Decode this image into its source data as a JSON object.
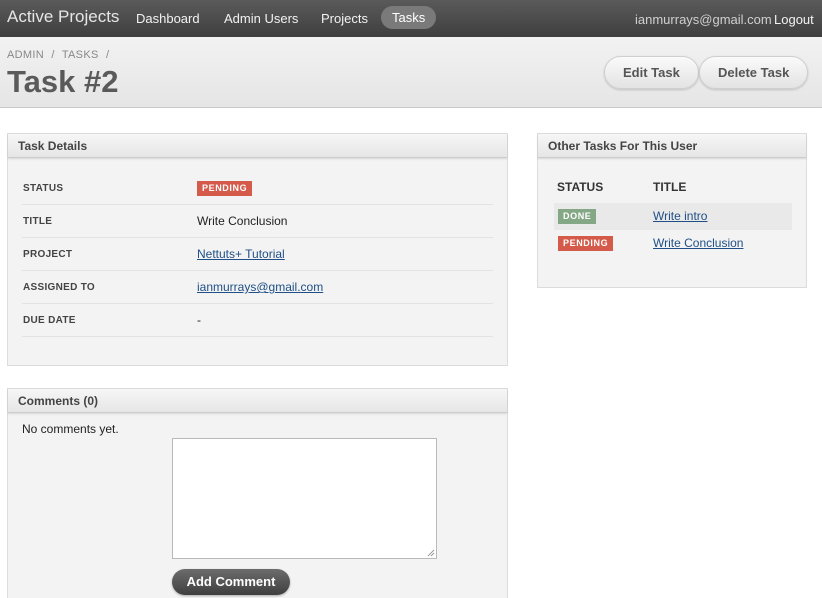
{
  "nav": {
    "brand": "Active Projects",
    "items": [
      {
        "label": "Dashboard",
        "active": false
      },
      {
        "label": "Admin Users",
        "active": false
      },
      {
        "label": "Projects",
        "active": false
      },
      {
        "label": "Tasks",
        "active": true
      }
    ],
    "user_email": "ianmurrays@gmail.com",
    "logout": "Logout"
  },
  "breadcrumb": [
    "ADMIN",
    "/",
    "TASKS",
    "/"
  ],
  "page_title": "Task #2",
  "actions": {
    "edit": "Edit Task",
    "delete": "Delete Task"
  },
  "task_details": {
    "header": "Task Details",
    "rows": [
      {
        "label": "STATUS",
        "value": "PENDING"
      },
      {
        "label": "TITLE",
        "value": "Write Conclusion"
      },
      {
        "label": "PROJECT",
        "value": "Nettuts+ Tutorial"
      },
      {
        "label": "ASSIGNED TO",
        "value": "ianmurrays@gmail.com"
      },
      {
        "label": "DUE DATE",
        "value": "-"
      }
    ]
  },
  "other_tasks": {
    "header": "Other Tasks For This User",
    "columns": [
      "STATUS",
      "TITLE"
    ],
    "rows": [
      {
        "status": "DONE",
        "title": "Write intro"
      },
      {
        "status": "PENDING",
        "title": "Write Conclusion"
      }
    ]
  },
  "comments": {
    "header": "Comments (0)",
    "empty_text": "No comments yet.",
    "button": "Add Comment"
  },
  "colors": {
    "pending": "#d45a4a",
    "done": "#84a886",
    "link": "#1f4f86"
  }
}
